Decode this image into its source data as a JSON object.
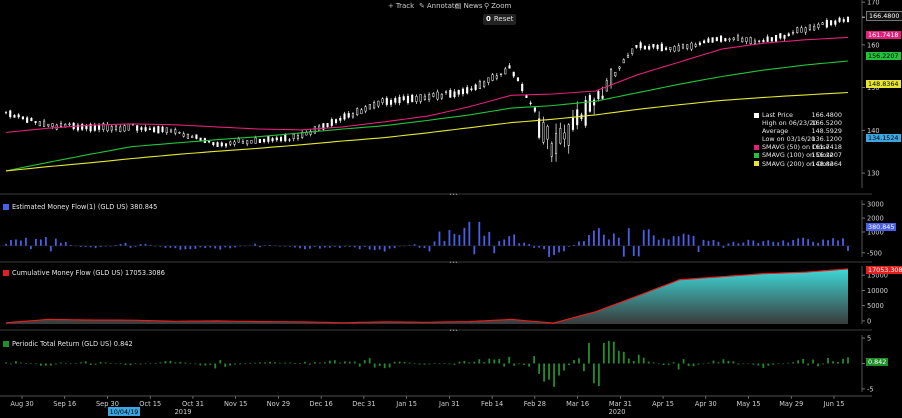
{
  "toolbar": {
    "track": "Track",
    "annotate": "Annotate",
    "news": "News",
    "zoom": "Zoom",
    "reset": "Reset"
  },
  "colors": {
    "price": "#ffffff",
    "smavg50": "#e0207a",
    "smavg100": "#22c33a",
    "smavg200": "#e6e632",
    "money_flow": "#4a5fe8",
    "cumulative_line": "#e02020",
    "cumulative_fill_top": "#3ed8d8",
    "cumulative_fill_bottom": "#3a3a3a",
    "total_return": "#1f8f2a"
  },
  "panels": {
    "price": {
      "legend": [
        {
          "label": "Last Price",
          "value": "166.4800",
          "color": "#ffffff"
        },
        {
          "label": "High on 06/23/20",
          "value": "166.5200",
          "color": ""
        },
        {
          "label": "Average",
          "value": "148.5929",
          "color": ""
        },
        {
          "label": "Low on 03/16/20",
          "value": "136.1200",
          "color": ""
        },
        {
          "label": "SMAVG (50)  on Close",
          "value": "161.7418",
          "color": "#e0207a"
        },
        {
          "label": "SMAVG (100)  on Close",
          "value": "156.2207",
          "color": "#22c33a"
        },
        {
          "label": "SMAVG (200)  on Close",
          "value": "148.8364",
          "color": "#e6e632"
        }
      ],
      "tags": {
        "last": "166.4800",
        "sma50": "161.7418",
        "sma100": "156.2207",
        "sma200": "148.8364",
        "cursor": "134.1524"
      }
    },
    "money_flow": {
      "title": "Estimated Money Flow(1) (GLD US) 380.845",
      "tag": "380.845"
    },
    "cumulative": {
      "title": "Cumulative Money Flow (GLD US) 17053.3086",
      "tag": "17053.3086"
    },
    "total_return": {
      "title": "Periodic Total Return (GLD US) 0.842",
      "tag": "0.842"
    }
  },
  "x_axis": {
    "labels": [
      "Aug 30",
      "Sep 16",
      "Sep 30",
      "Oct 15",
      "Oct 31",
      "Nov 15",
      "Nov 29",
      "Dec 16",
      "Dec 31",
      "Jan 15",
      "Jan 31",
      "Feb 14",
      "Feb 28",
      "Mar 16",
      "Mar 31",
      "Apr 15",
      "Apr 30",
      "May 15",
      "May 29",
      "Jun 15"
    ],
    "years": [
      "2019",
      "2020"
    ],
    "cursor_date": "10/04/19"
  },
  "chart_data": [
    {
      "type": "line",
      "title": "",
      "x": [
        "Aug 30",
        "Sep 16",
        "Sep 30",
        "Oct 15",
        "Oct 31",
        "Nov 15",
        "Nov 29",
        "Dec 16",
        "Dec 31",
        "Jan 15",
        "Jan 31",
        "Feb 14",
        "Feb 28",
        "Mar 16",
        "Mar 31",
        "Apr 15",
        "Apr 30",
        "May 15",
        "May 29",
        "Jun 15",
        "Jun 23"
      ],
      "series": [
        {
          "name": "Last Price",
          "values": [
            144.5,
            141.5,
            141.2,
            141.0,
            140.2,
            137.3,
            138.2,
            139.2,
            143.5,
            147.2,
            148.2,
            149.7,
            154.9,
            137.5,
            148.5,
            160.2,
            159.6,
            162.0,
            161.2,
            164.2,
            166.48
          ]
        },
        {
          "name": "SMAVG (50) on Close",
          "values": [
            139.5,
            140.5,
            141.2,
            141.5,
            141.3,
            140.8,
            140.3,
            140.1,
            140.8,
            142.0,
            143.3,
            145.5,
            148.2,
            148.5,
            149.2,
            153.0,
            156.0,
            159.0,
            160.4,
            161.2,
            161.74
          ]
        },
        {
          "name": "SMAVG (100) on Close",
          "values": [
            130.5,
            132.5,
            134.4,
            136.2,
            137.0,
            137.8,
            138.5,
            139.4,
            140.3,
            141.1,
            142.3,
            143.6,
            145.2,
            145.8,
            146.8,
            148.8,
            150.8,
            152.6,
            154.1,
            155.3,
            156.22
          ]
        },
        {
          "name": "SMAVG (200) on Close",
          "values": [
            130.5,
            131.5,
            132.4,
            133.4,
            134.3,
            135.1,
            135.8,
            136.6,
            137.5,
            138.3,
            139.4,
            140.6,
            141.8,
            142.6,
            143.6,
            144.9,
            146.0,
            147.0,
            147.7,
            148.3,
            148.84
          ]
        }
      ],
      "yticks": [
        130,
        140,
        150,
        160,
        170
      ],
      "ylim": [
        126.5,
        170.5
      ]
    },
    {
      "type": "bar",
      "title": "Estimated Money Flow(1) (GLD US) 380.845",
      "x": [
        "Aug 30",
        "Sep 16",
        "Sep 30",
        "Oct 15",
        "Oct 31",
        "Nov 15",
        "Nov 29",
        "Dec 16",
        "Dec 31",
        "Jan 15",
        "Jan 31",
        "Feb 14",
        "Feb 28",
        "Mar 16",
        "Mar 31",
        "Apr 15",
        "Apr 30",
        "May 15",
        "May 29",
        "Jun 15",
        "Jun 23"
      ],
      "values": [
        350,
        400,
        -180,
        200,
        -160,
        -220,
        120,
        -140,
        -90,
        -260,
        330,
        1200,
        650,
        -700,
        900,
        720,
        560,
        420,
        230,
        440,
        380.845
      ],
      "yticks": [
        -500,
        1000,
        2000,
        3000
      ],
      "ylim": [
        -800,
        3300
      ]
    },
    {
      "type": "area",
      "title": "Cumulative Money Flow (GLD US) 17053.3086",
      "x": [
        "Aug 30",
        "Sep 16",
        "Sep 30",
        "Oct 15",
        "Oct 31",
        "Nov 15",
        "Nov 29",
        "Dec 16",
        "Dec 31",
        "Jan 15",
        "Jan 31",
        "Feb 14",
        "Feb 28",
        "Mar 16",
        "Mar 31",
        "Apr 15",
        "Apr 30",
        "May 15",
        "May 29",
        "Jun 15",
        "Jun 23"
      ],
      "values": [
        -600,
        500,
        300,
        250,
        -100,
        0,
        -200,
        -300,
        -600,
        -300,
        -450,
        -200,
        500,
        -700,
        3000,
        8200,
        13500,
        14500,
        15500,
        16000,
        17053.3086
      ],
      "yticks": [
        0,
        5000,
        10000,
        15000
      ],
      "ylim": [
        -1000,
        18000
      ]
    },
    {
      "type": "bar",
      "title": "Periodic Total Return (GLD US) 0.842",
      "x": [
        "Aug 30",
        "Sep 16",
        "Sep 30",
        "Oct 15",
        "Oct 31",
        "Nov 15",
        "Nov 29",
        "Dec 16",
        "Dec 31",
        "Jan 15",
        "Jan 31",
        "Feb 14",
        "Feb 28",
        "Mar 16",
        "Mar 31",
        "Apr 15",
        "Apr 30",
        "May 15",
        "May 29",
        "Jun 15",
        "Jun 23"
      ],
      "values": [
        0.6,
        -0.5,
        0.4,
        -0.3,
        0.5,
        -0.8,
        0.3,
        0.2,
        0.6,
        0.9,
        -0.4,
        0.7,
        1.0,
        -3.5,
        4.9,
        1.3,
        -1.2,
        0.9,
        -0.6,
        0.7,
        0.842
      ],
      "yticks": [
        -5,
        0,
        5
      ],
      "ylim": [
        -5.6,
        5.6
      ]
    }
  ]
}
